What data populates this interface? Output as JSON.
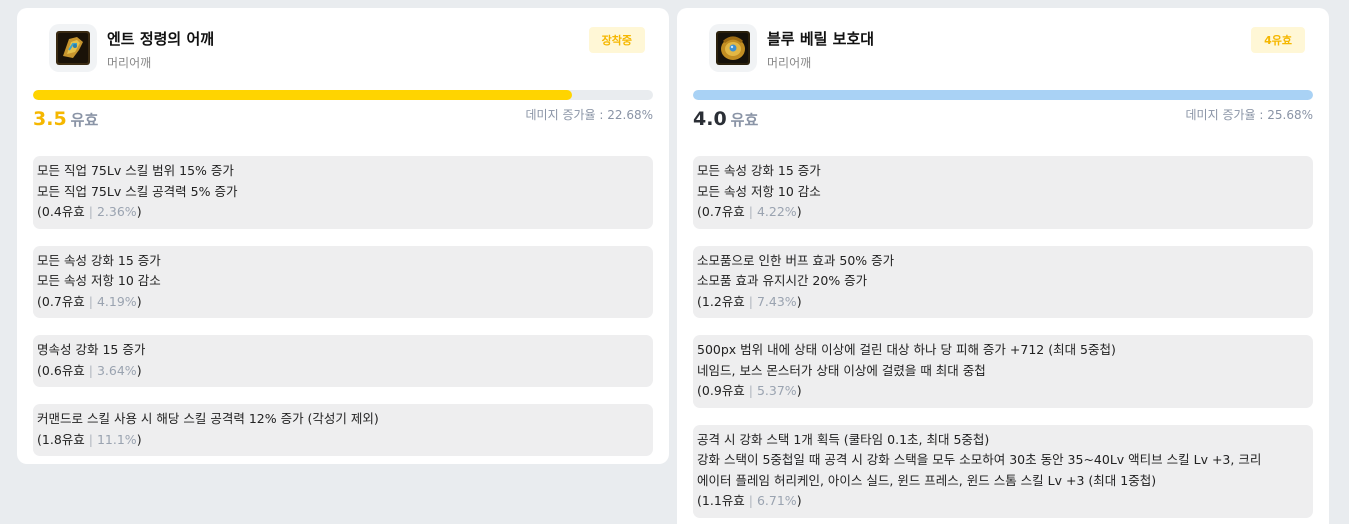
{
  "cards": [
    {
      "name": "엔트 정령의 어깨",
      "slot": "머리어깨",
      "badge": "장착중",
      "bar": {
        "fraction": 0.87,
        "color": "#ffd400"
      },
      "score_value": "3.5",
      "score_color": "#f5b700",
      "score_unit": "유효",
      "damage_text": "데미지 증가율 : 22.68%",
      "options": [
        {
          "lines": [
            "모든 직업 75Lv 스킬 범위 15% 증가",
            "모든 직업 75Lv 스킬 공격력 5% 증가"
          ],
          "open": "(",
          "value": "0.4유효",
          "sep": "|",
          "pct": "2.36%",
          "close": ")"
        },
        {
          "lines": [
            "모든 속성 강화 15 증가",
            "모든 속성 저항 10 감소"
          ],
          "open": "(",
          "value": "0.7유효",
          "sep": "|",
          "pct": "4.19%",
          "close": ")"
        },
        {
          "lines": [
            "명속성 강화 15 증가"
          ],
          "open": "(",
          "value": "0.6유효",
          "sep": "|",
          "pct": "3.64%",
          "close": ")"
        },
        {
          "lines": [
            "커맨드로 스킬 사용 시 해당 스킬 공격력 12% 증가 (각성기 제외)"
          ],
          "open": "(",
          "value": "1.8유효",
          "sep": "|",
          "pct": "11.1%",
          "close": ")"
        }
      ]
    },
    {
      "name": "블루 베릴 보호대",
      "slot": "머리어깨",
      "badge": "4유효",
      "bar": {
        "fraction": 1.0,
        "color": "#a9d2f5"
      },
      "score_value": "4.0",
      "score_color": "#2b2f36",
      "score_unit": "유효",
      "damage_text": "데미지 증가율 : 25.68%",
      "options": [
        {
          "lines": [
            "모든 속성 강화 15 증가",
            "모든 속성 저항 10 감소"
          ],
          "open": "(",
          "value": "0.7유효",
          "sep": "|",
          "pct": "4.22%",
          "close": ")"
        },
        {
          "lines": [
            "소모품으로 인한 버프 효과 50% 증가",
            "소모품 효과 유지시간 20% 증가"
          ],
          "open": "(",
          "value": "1.2유효",
          "sep": "|",
          "pct": "7.43%",
          "close": ")"
        },
        {
          "lines": [
            "500px 범위 내에 상태 이상에 걸린 대상 하나 당 피해 증가 +712 (최대 5중첩)",
            "네임드, 보스 몬스터가 상태 이상에 걸렸을 때 최대 중첩"
          ],
          "open": "(",
          "value": "0.9유효",
          "sep": "|",
          "pct": "5.37%",
          "close": ")"
        },
        {
          "lines": [
            "공격 시 강화 스택 1개 획득 (쿨타임 0.1초, 최대 5중첩)",
            "강화 스택이 5중첩일 때 공격 시 강화 스택을 모두 소모하여 30초 동안 35~40Lv 액티브 스킬 Lv +3, 크리",
            "에이터 플레임 허리케인, 아이스 실드, 윈드 프레스, 윈드 스톰 스킬 Lv +3 (최대 1중첩)"
          ],
          "open": "(",
          "value": "1.1유효",
          "sep": "|",
          "pct": "6.71%",
          "close": ")"
        }
      ]
    }
  ]
}
